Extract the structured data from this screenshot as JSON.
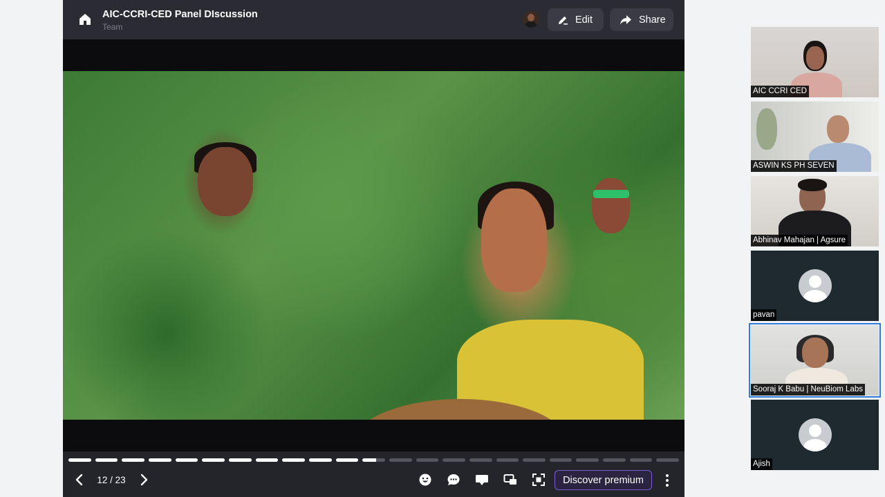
{
  "presentation": {
    "title": "AIC-CCRI-CED Panel DIscussion",
    "subtitle": "Team",
    "edit_label": "Edit",
    "share_label": "Share",
    "current_slide": 12,
    "total_slides": 23,
    "page_indicator": "12 / 23",
    "premium_label": "Discover premium"
  },
  "participants": [
    {
      "name": "AIC CCRI CED",
      "video": true
    },
    {
      "name": "ASWIN KS PH SEVEN",
      "video": true
    },
    {
      "name": "Abhinav Mahajan | Agsure",
      "video": true
    },
    {
      "name": "pavan",
      "video": false
    },
    {
      "name": "Sooraj K Babu | NeuBiom Labs",
      "video": true,
      "active": true
    },
    {
      "name": "Ajish",
      "video": false
    }
  ],
  "colors": {
    "accent_premium": "#7b5cd6",
    "active_speaker": "#2f7bdb",
    "panel_bg": "#24252b"
  }
}
